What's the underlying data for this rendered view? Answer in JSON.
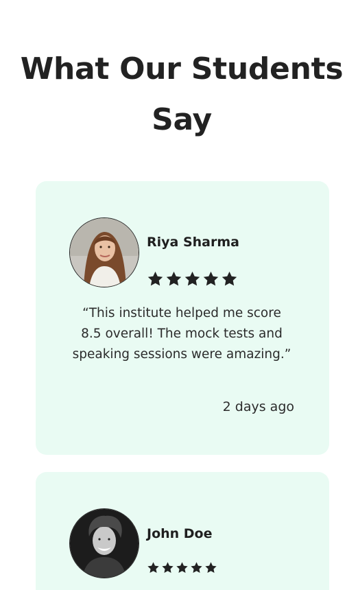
{
  "section": {
    "title": "What Our Students Say"
  },
  "testimonials": [
    {
      "name": "Riya Sharma",
      "rating": 5,
      "quote": "“This institute helped me score 8.5 overall! The mock tests and speaking sessions were amazing.”",
      "time": "2 days ago"
    },
    {
      "name": "John Doe",
      "rating": 5
    }
  ],
  "colors": {
    "card_background": "#e9fbf3",
    "star": "#222222",
    "text": "#1f1f1f"
  },
  "icons": [
    "star-icon"
  ]
}
